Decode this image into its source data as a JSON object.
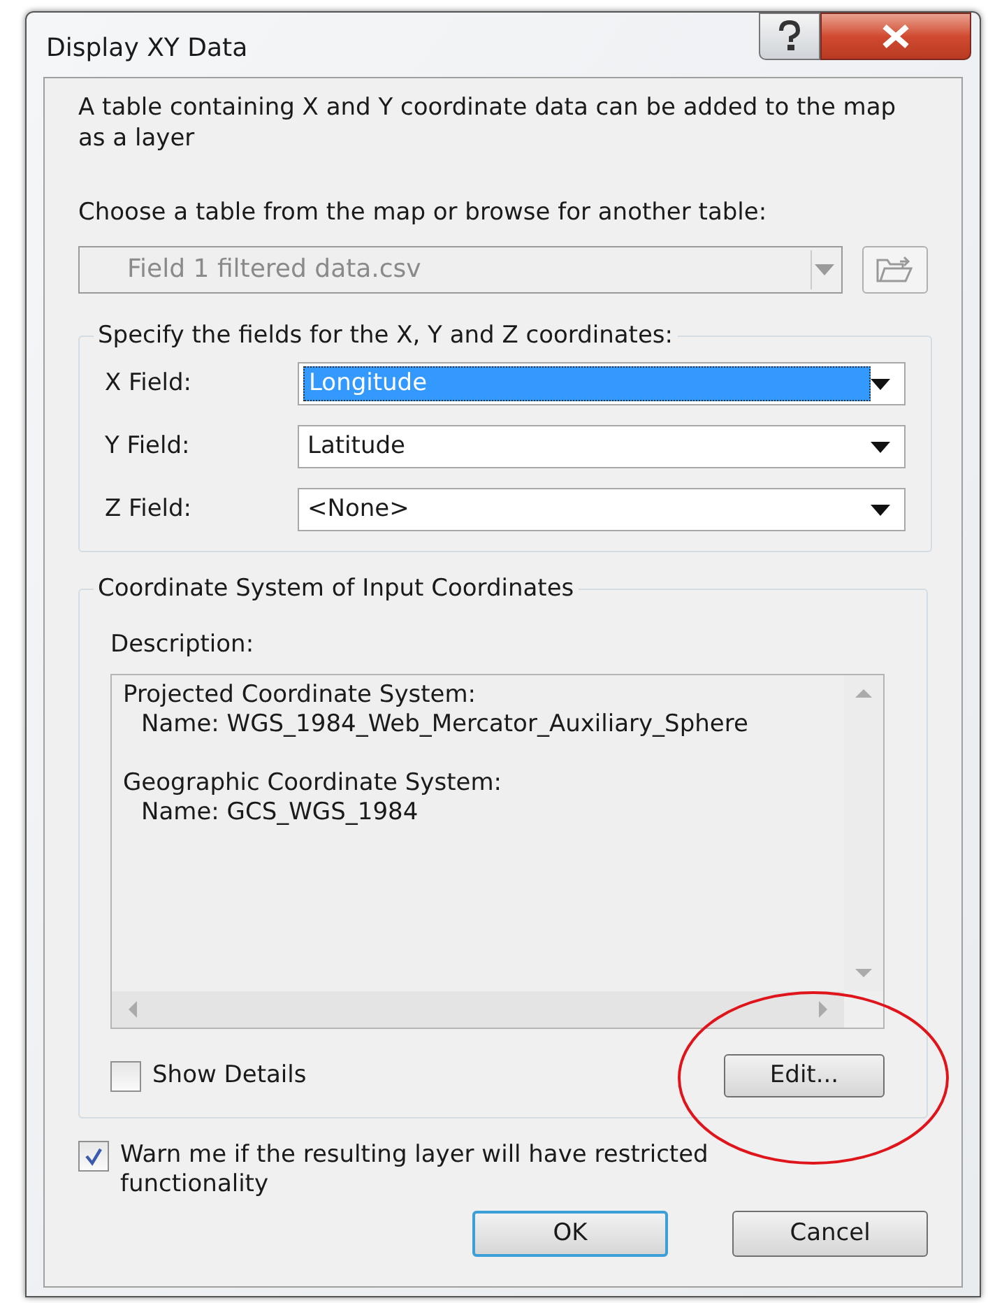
{
  "window": {
    "title": "Display XY Data"
  },
  "intro": "A table containing X and Y coordinate data can be added to the map as a layer",
  "table_prompt": "Choose a table from the map or browse for another table:",
  "table_select": {
    "value": "Field 1 filtered data.csv",
    "disabled": true
  },
  "fields_group": {
    "title": "Specify the fields for the X, Y and Z coordinates:",
    "fields": [
      {
        "label": "X Field:",
        "value": "Longitude",
        "selected": true
      },
      {
        "label": "Y Field:",
        "value": "Latitude",
        "selected": false
      },
      {
        "label": "Z Field:",
        "value": "<None>",
        "selected": false
      }
    ]
  },
  "coordinate_group": {
    "title": "Coordinate System of Input Coordinates",
    "description_label": "Description:",
    "systems": [
      {
        "heading": "Projected Coordinate System:",
        "name": "Name: WGS_1984_Web_Mercator_Auxiliary_Sphere"
      },
      {
        "heading": "Geographic Coordinate System:",
        "name": "Name: GCS_WGS_1984"
      }
    ],
    "show_details": {
      "label": "Show Details",
      "checked": false
    },
    "edit_button": "Edit..."
  },
  "warn": {
    "label": "Warn me if the resulting layer will have restricted functionality",
    "checked": true
  },
  "buttons": [
    {
      "label": "OK",
      "default": true
    },
    {
      "label": "Cancel",
      "default": false
    }
  ]
}
